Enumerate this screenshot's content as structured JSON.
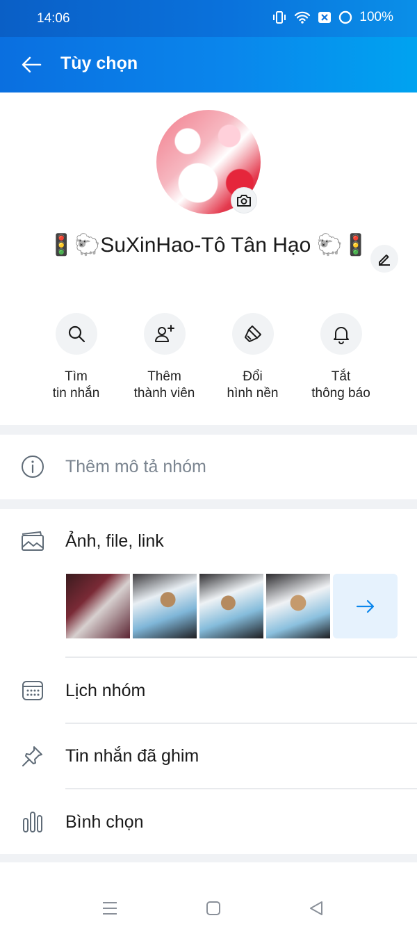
{
  "status_bar": {
    "time": "14:06",
    "battery": "100%",
    "icons": [
      "vibrate-icon",
      "wifi-icon",
      "close-box-icon",
      "battery-icon"
    ]
  },
  "header": {
    "title": "Tùy chọn",
    "back_icon": "arrow-left-icon"
  },
  "profile": {
    "group_name": "🚦🐑SuXinHao-Tô Tân Hạo 🐑🚦",
    "camera_icon": "camera-icon",
    "edit_icon": "pencil-icon"
  },
  "actions": [
    {
      "label": "Tìm\ntin nhắn",
      "icon": "search-icon"
    },
    {
      "label": "Thêm\nthành viên",
      "icon": "add-member-icon"
    },
    {
      "label": "Đổi\nhình nền",
      "icon": "paint-brush-icon"
    },
    {
      "label": "Tắt\nthông báo",
      "icon": "bell-icon"
    }
  ],
  "description_row": {
    "label": "Thêm mô tả nhóm",
    "icon": "info-icon"
  },
  "media_row": {
    "label": "Ảnh, file, link",
    "icon": "image-icon",
    "more_icon": "arrow-right-icon"
  },
  "menu": [
    {
      "label": "Lịch nhóm",
      "icon": "calendar-icon"
    },
    {
      "label": "Tin nhắn đã ghim",
      "icon": "pin-icon"
    },
    {
      "label": "Bình chọn",
      "icon": "poll-icon"
    }
  ],
  "colors": {
    "header_start": "#0a6fe0",
    "header_end": "#00a3f0",
    "accent": "#0a86ec",
    "icon_gray": "#5f6b77",
    "divider": "#f0f2f5"
  }
}
